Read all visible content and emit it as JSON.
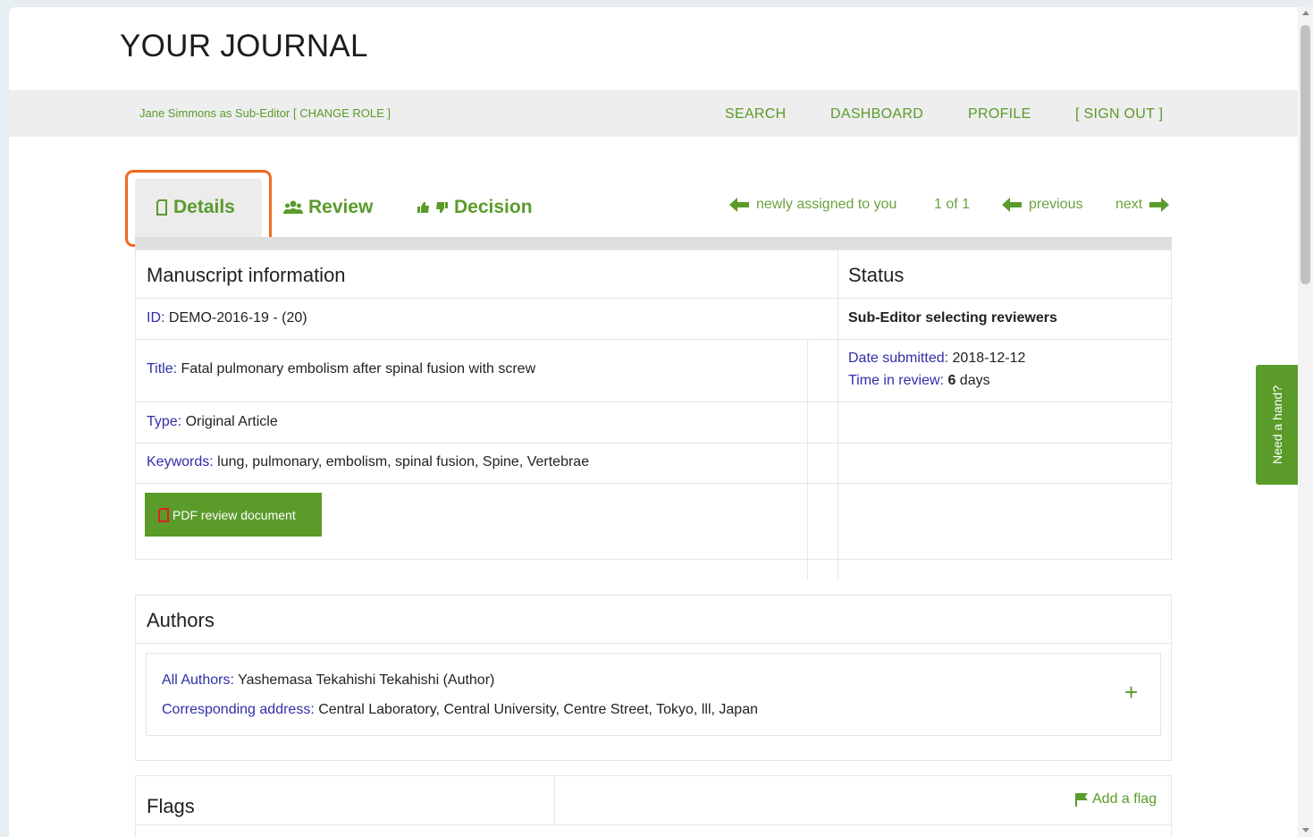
{
  "header": {
    "journal_title": "YOUR JOURNAL"
  },
  "topbar": {
    "role": "Jane Simmons as Sub-Editor [ CHANGE ROLE ]",
    "nav": [
      "SEARCH",
      "DASHBOARD",
      "PROFILE",
      "[ SIGN OUT ]"
    ]
  },
  "tabs": {
    "details": "Details",
    "review": "Review",
    "decision": "Decision"
  },
  "pager": {
    "queue": "newly assigned to you",
    "count": "1 of 1",
    "previous": "previous",
    "next": "next"
  },
  "manuscript": {
    "heading": "Manuscript information",
    "id_label": "ID:",
    "id_value": "DEMO-2016-19 - (20)",
    "title_label": "Title:",
    "title_value": "Fatal pulmonary embolism after spinal fusion with screw",
    "type_label": "Type:",
    "type_value": "Original Article",
    "keywords_label": "Keywords:",
    "keywords_value": "lung, pulmonary, embolism, spinal fusion, Spine, Vertebrae",
    "pdf_button": "PDF review document"
  },
  "status": {
    "heading": "Status",
    "state": "Sub-Editor selecting reviewers",
    "submitted_label": "Date submitted:",
    "submitted_value": "2018-12-12",
    "review_label": "Time in review:",
    "review_value": "6",
    "review_unit": "days"
  },
  "authors": {
    "heading": "Authors",
    "all_label": "All Authors:",
    "all_value": "Yashemasa Tekahishi Tekahishi (Author)",
    "addr_label": "Corresponding address:",
    "addr_value": "Central Laboratory, Central University, Centre Street, Tokyo, lll, Japan",
    "expand": "+"
  },
  "flags": {
    "heading": "Flags",
    "add": "Add a flag"
  },
  "help": {
    "label": "Need a hand?"
  },
  "colors": {
    "accent": "#5a9b2a",
    "label_blue": "#2f2fa8",
    "highlight": "#f06a1e"
  }
}
